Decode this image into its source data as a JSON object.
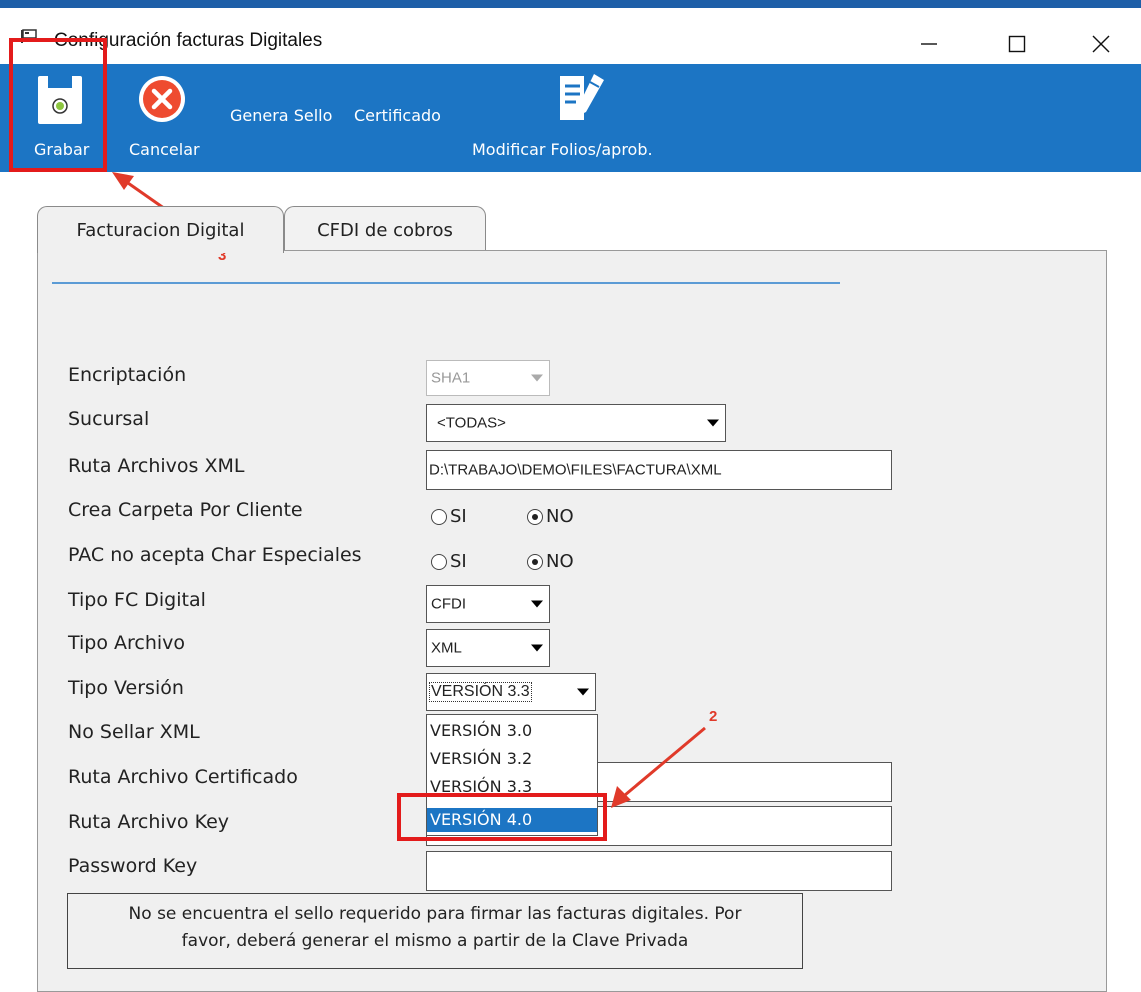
{
  "window": {
    "title": "Configuración facturas Digitales",
    "controls": {
      "minimize": "minimize-icon",
      "maximize": "maximize-icon",
      "close": "close-icon"
    }
  },
  "toolbar": {
    "grabar": "Grabar",
    "cancelar": "Cancelar",
    "genera_sello": "Genera Sello",
    "certificado": "Certificado",
    "modificar": "Modificar Folios/aprob."
  },
  "tabs": [
    {
      "label": "Facturacion Digital",
      "active": true
    },
    {
      "label": "CFDI de cobros",
      "active": false
    }
  ],
  "form": {
    "encriptacion": {
      "label": "Encriptación",
      "value": "SHA1"
    },
    "sucursal": {
      "label": "Sucursal",
      "value": "<TODAS>"
    },
    "ruta_xml": {
      "label": "Ruta Archivos XML",
      "value": "D:\\TRABAJO\\DEMO\\FILES\\FACTURA\\XML"
    },
    "crea_carpeta": {
      "label": "Crea Carpeta Por Cliente",
      "si": "SI",
      "no": "NO",
      "selected": "NO"
    },
    "pac_char": {
      "label": "PAC no acepta Char Especiales",
      "si": "SI",
      "no": "NO",
      "selected": "NO"
    },
    "tipo_fc": {
      "label": "Tipo FC Digital",
      "value": "CFDI"
    },
    "tipo_archivo": {
      "label": "Tipo Archivo",
      "value": "XML"
    },
    "tipo_version": {
      "label": "Tipo Versión",
      "value": "VERSIÓN 3.3",
      "options": [
        "VERSIÓN 3.0",
        "VERSIÓN 3.2",
        "VERSIÓN 3.3",
        "VERSIÓN 4.0"
      ],
      "highlighted": "VERSIÓN 4.0"
    },
    "no_sellar": {
      "label": "No Sellar XML"
    },
    "ruta_cert": {
      "label": "Ruta Archivo Certificado",
      "value": ""
    },
    "ruta_key": {
      "label": "Ruta Archivo Key",
      "value": ""
    },
    "password": {
      "label": "Password Key",
      "value": ""
    }
  },
  "message": {
    "line1": "No se encuentra el sello requerido para firmar las facturas digitales. Por",
    "line2": "favor, deberá generar el mismo a partir de la Clave Privada"
  },
  "annotations": {
    "num2": "2",
    "num3": "3",
    "color": "#e31b1b"
  },
  "colors": {
    "toolbar": "#1c75c4",
    "panel": "#f0f0f0",
    "selection": "#1c75c4"
  }
}
